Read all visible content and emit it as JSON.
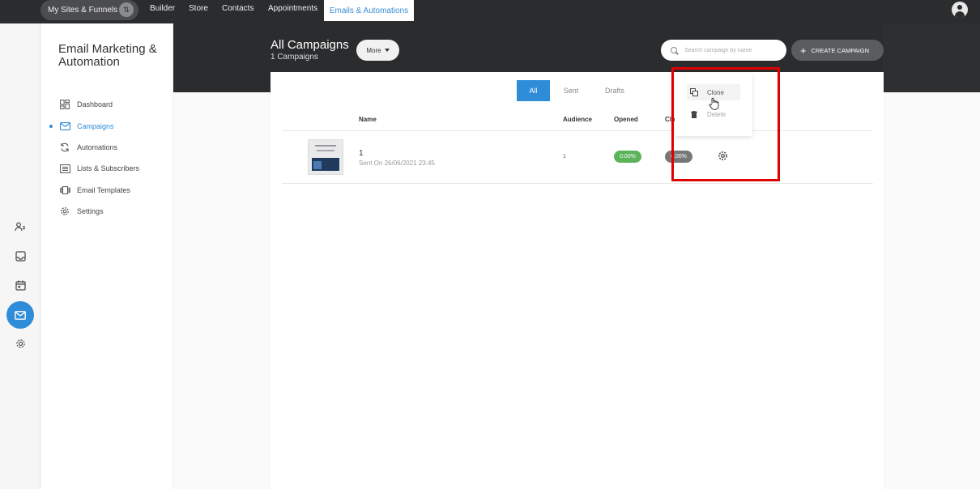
{
  "topnav": {
    "sites_label": "My Sites & Funnels",
    "items": [
      "Builder",
      "Store",
      "Contacts",
      "Appointments"
    ],
    "active": "Emails & Automations"
  },
  "sidebar": {
    "title": "Email Marketing & Automation",
    "items": [
      {
        "label": "Dashboard",
        "icon": "dashboard-icon"
      },
      {
        "label": "Campaigns",
        "icon": "mail-icon",
        "active": true
      },
      {
        "label": "Automations",
        "icon": "refresh-icon"
      },
      {
        "label": "Lists & Subscribers",
        "icon": "list-icon"
      },
      {
        "label": "Email Templates",
        "icon": "template-icon"
      },
      {
        "label": "Settings",
        "icon": "gear-icon"
      }
    ]
  },
  "header": {
    "title": "All Campaigns",
    "subtitle": "1 Campaigns",
    "more_label": "More",
    "search_placeholder": "Search campaign by name",
    "create_label": "CREATE CAMPAIGN"
  },
  "tabs": [
    "All",
    "Sent",
    "Drafts"
  ],
  "table": {
    "headers": {
      "name": "Name",
      "audience": "Audience",
      "opened": "Opened",
      "clicked": "Clic"
    },
    "rows": [
      {
        "name": "1",
        "sent": "Sent On 26/06/2021 23:45",
        "audience": "1",
        "opened": "0.00%",
        "clicked": "0.00%"
      }
    ]
  },
  "dropdown": {
    "clone": "Clone",
    "delete": "Delete"
  },
  "colors": {
    "accent": "#2f8cd8",
    "topbar": "#2b2c2e",
    "opened_pill": "#5bb35a",
    "highlight": "#e00000"
  }
}
